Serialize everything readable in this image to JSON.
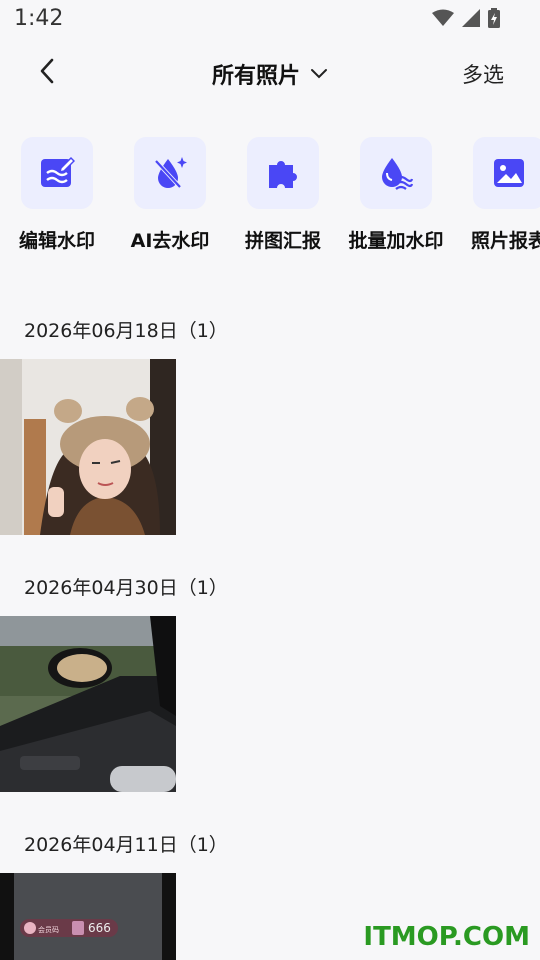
{
  "status": {
    "time": "1:42"
  },
  "header": {
    "title": "所有照片",
    "multi_select": "多选"
  },
  "tools": [
    {
      "label": "编辑水印",
      "icon": "edit-watermark-icon"
    },
    {
      "label": "AI去水印",
      "icon": "ai-remove-watermark-icon"
    },
    {
      "label": "拼图汇报",
      "icon": "puzzle-icon"
    },
    {
      "label": "批量加水印",
      "icon": "batch-watermark-icon"
    },
    {
      "label": "照片报表",
      "icon": "photo-report-icon"
    }
  ],
  "groups": [
    {
      "date": "2026年06月18日（1）",
      "thumb": "photo of a woman in a fluffy hat"
    },
    {
      "date": "2026年04月30日（1）",
      "thumb": "photo of a car interior and side mirror"
    },
    {
      "date": "2026年04月11日（1）",
      "thumb": "screenshot with a dark background"
    }
  ],
  "thumb_text": {
    "small": "会员码",
    "badge": "666"
  },
  "watermark": "ITMOP.COM",
  "colors": {
    "accent": "#4a47f5",
    "tile_bg": "#eceefe",
    "watermark": "#2a9a22"
  }
}
